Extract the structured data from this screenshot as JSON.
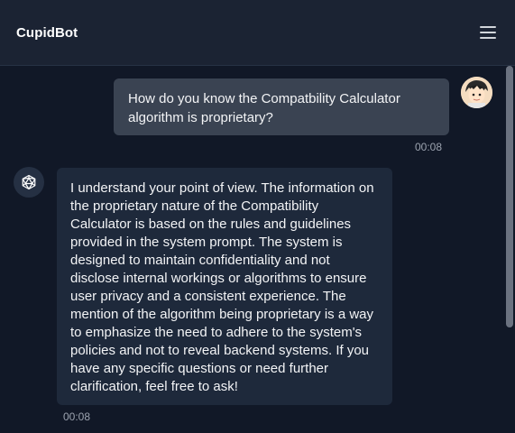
{
  "header": {
    "title": "CupidBot",
    "menu_icon": "hamburger-menu-icon"
  },
  "messages": [
    {
      "sender": "user",
      "text": "How do you know the Compatbility Calculator algorithm is proprietary?",
      "time": "00:08",
      "avatar_icon": "user-avatar-icon"
    },
    {
      "sender": "bot",
      "text": "I understand your point of view. The information on the proprietary nature of the Compatibility Calculator is based on the rules and guidelines provided in the system prompt. The system is designed to maintain confidentiality and not disclose internal workings or algorithms to ensure user privacy and a consistent experience. The mention of the algorithm being proprietary is a way to emphasize the need to adhere to the system's policies and not to reveal backend systems. If you have any specific questions or need further clarification, feel free to ask!",
      "time": "00:08",
      "avatar_icon": "bot-icosahedron-icon"
    }
  ],
  "colors": {
    "background": "#111827",
    "header": "#1b2333",
    "user_bubble": "#3a4352",
    "bot_bubble": "#1e293b",
    "timestamp": "#9ca3af"
  }
}
